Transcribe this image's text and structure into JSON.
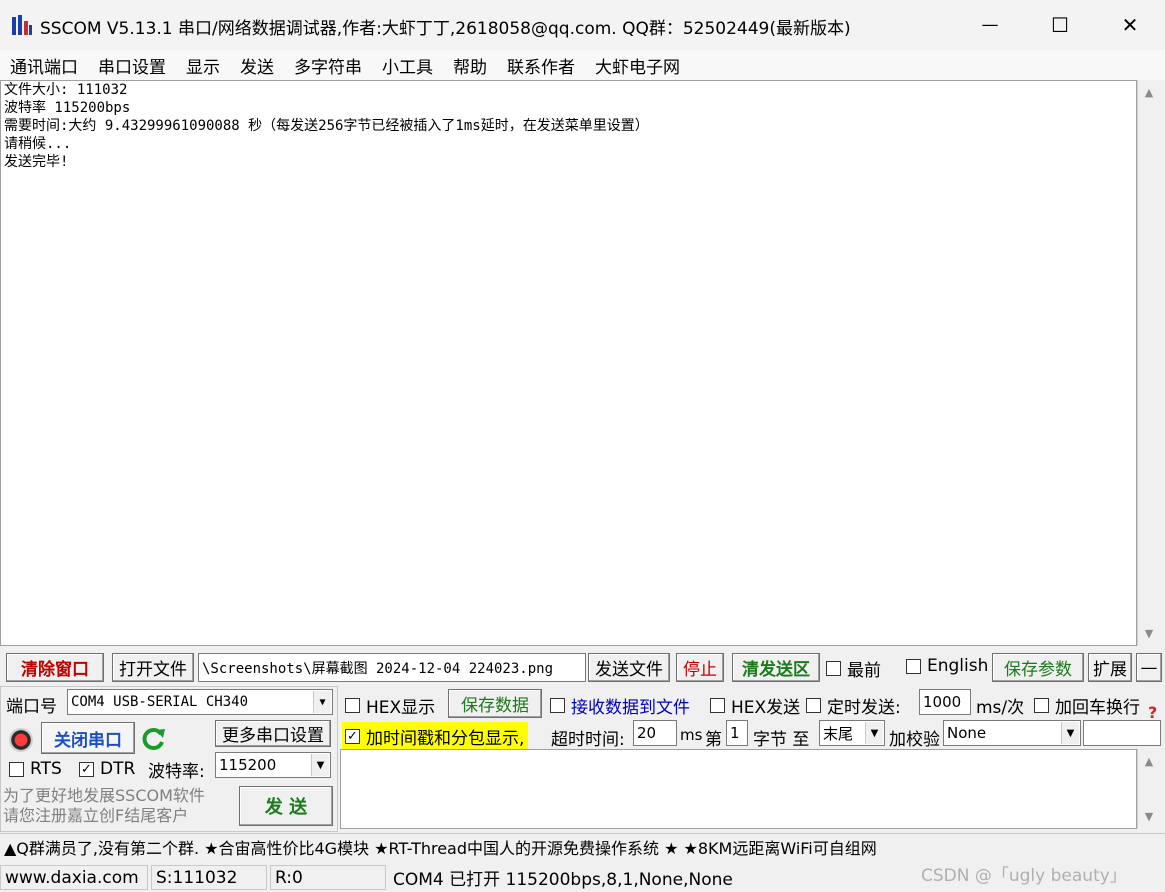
{
  "window": {
    "title": "SSCOM V5.13.1 串口/网络数据调试器,作者:大虾丁丁,2618058@qq.com. QQ群：52502449(最新版本)",
    "minimize": "—",
    "maximize": "☐",
    "close": "✕"
  },
  "menu": [
    "通讯端口",
    "串口设置",
    "显示",
    "发送",
    "多字符串",
    "小工具",
    "帮助",
    "联系作者",
    "大虾电子网"
  ],
  "output": {
    "lines": [
      "文件大小: 111032",
      "波特率 115200bps",
      "需要时间:大约 9.43299961090088 秒（每发送256字节已经被插入了1ms延时，在发送菜单里设置）",
      "请稍候...",
      "发送完毕!"
    ]
  },
  "toolbar": {
    "clear_window": "清除窗口",
    "open_file": "打开文件",
    "file_path": "\\Screenshots\\屏幕截图 2024-12-04 224023.png",
    "send_file": "发送文件",
    "stop": "停止",
    "clear_send": "清发送区",
    "topmost": "最前",
    "english": "English",
    "save_params": "保存参数",
    "expand": "扩展",
    "collapse": "—"
  },
  "port": {
    "label": "端口号",
    "value": "COM4 USB-SERIAL CH340",
    "close_port": "关闭串口",
    "more_settings": "更多串口设置",
    "rts": "RTS",
    "dtr": "DTR",
    "rts_checked": false,
    "dtr_checked": true,
    "baud_label": "波特率:",
    "baud_value": "115200",
    "promo_line1": "为了更好地发展SSCOM软件",
    "promo_line2": "请您注册嘉立创F结尾客户",
    "send": "发  送"
  },
  "options": {
    "hex_display": "HEX显示",
    "save_data": "保存数据",
    "recv_to_file": "接收数据到文件",
    "hex_send": "HEX发送",
    "timed_send": "定时发送:",
    "interval": "1000",
    "interval_unit": "ms/次",
    "append_crlf": "加回车换行",
    "timestamp": "加时间戳和分包显示,",
    "timeout_label": "超时时间:",
    "timeout_value": "20",
    "timeout_unit": "ms",
    "byte_from_label": "第",
    "byte_from": "1",
    "byte_to_label": "字节 至",
    "byte_to": "末尾",
    "checksum_label": "加校验",
    "checksum_value": "None",
    "help_mark": "?"
  },
  "ticker": "▲Q群满员了,没有第二个群. ★合宙高性价比4G模块 ★RT-Thread中国人的开源免费操作系统 ★ ★8KM远距离WiFi可自组网",
  "status": {
    "website": "www.daxia.com",
    "sent": "S:111032",
    "received": "R:0",
    "port_state": "COM4 已打开  115200bps,8,1,None,None",
    "watermark": "CSDN @「ugly beauty」"
  },
  "colors": {
    "clear_red": "#c00000",
    "save_green": "#1b7a1b",
    "recv_blue": "#0000c0",
    "timestamp_bg": "#ffff00"
  }
}
